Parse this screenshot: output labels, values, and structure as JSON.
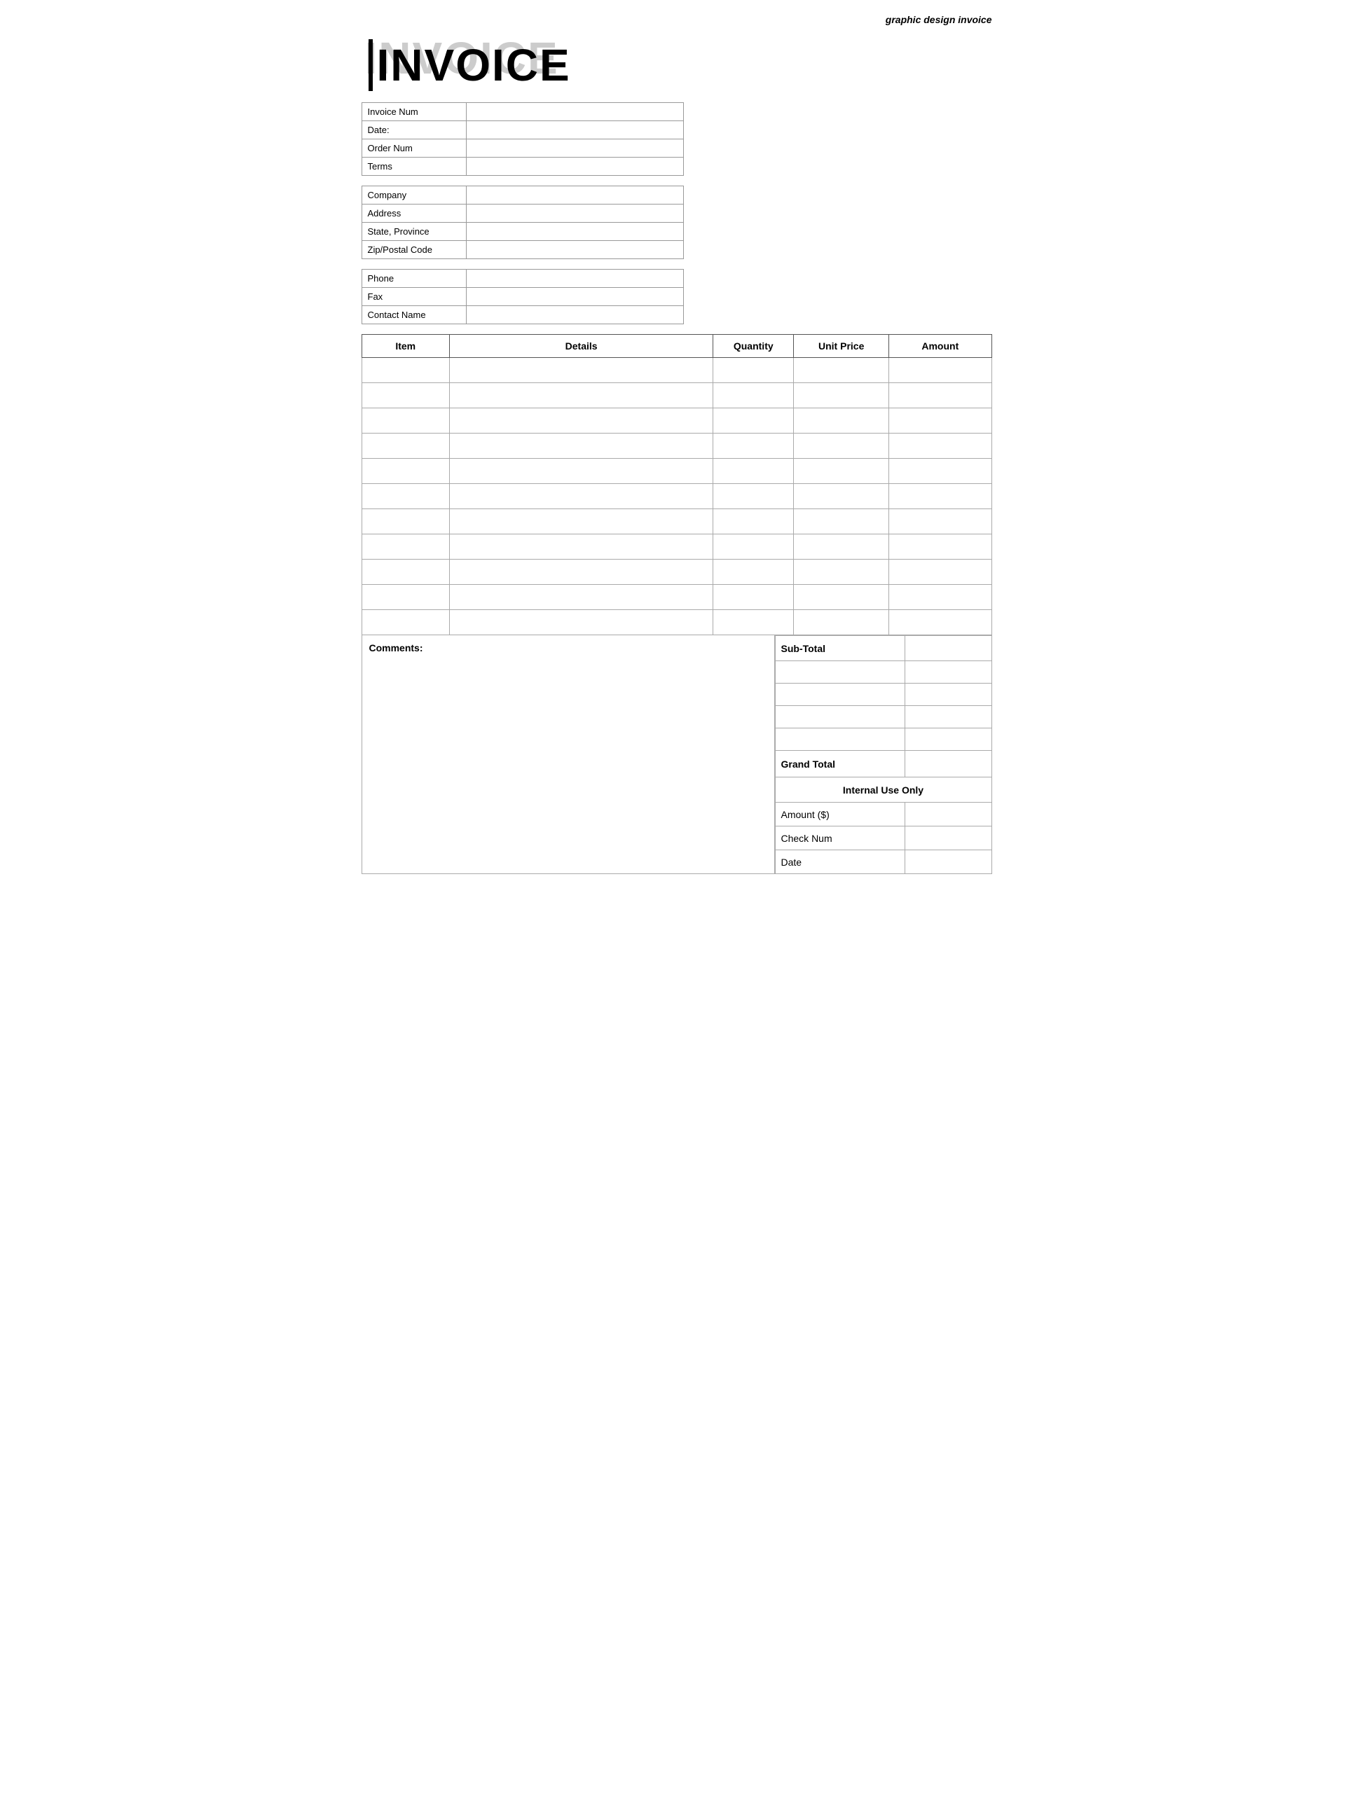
{
  "page": {
    "header": "graphic design invoice",
    "title_shadow": "INVOICE",
    "title_main": "INVOICE"
  },
  "invoice_info": {
    "fields": [
      {
        "label": "Invoice Num",
        "value": ""
      },
      {
        "label": "Date:",
        "value": ""
      },
      {
        "label": "Order Num",
        "value": ""
      },
      {
        "label": "Terms",
        "value": ""
      }
    ]
  },
  "company_info": {
    "fields": [
      {
        "label": "Company",
        "value": ""
      },
      {
        "label": "Address",
        "value": ""
      },
      {
        "label": "State, Province",
        "value": ""
      },
      {
        "label": "Zip/Postal Code",
        "value": ""
      }
    ]
  },
  "contact_info": {
    "fields": [
      {
        "label": "Phone",
        "value": ""
      },
      {
        "label": "Fax",
        "value": ""
      },
      {
        "label": "Contact Name",
        "value": ""
      }
    ]
  },
  "items_table": {
    "headers": {
      "item": "Item",
      "details": "Details",
      "quantity": "Quantity",
      "unit_price": "Unit Price",
      "amount": "Amount"
    },
    "rows": 11
  },
  "comments_label": "Comments:",
  "totals": {
    "subtotal_label": "Sub-Total",
    "blank_rows": 4,
    "grand_total_label": "Grand Total",
    "internal_use_label": "Internal Use Only",
    "internal_fields": [
      {
        "label": "Amount ($)",
        "value": ""
      },
      {
        "label": "Check Num",
        "value": ""
      },
      {
        "label": "Date",
        "value": ""
      }
    ]
  }
}
